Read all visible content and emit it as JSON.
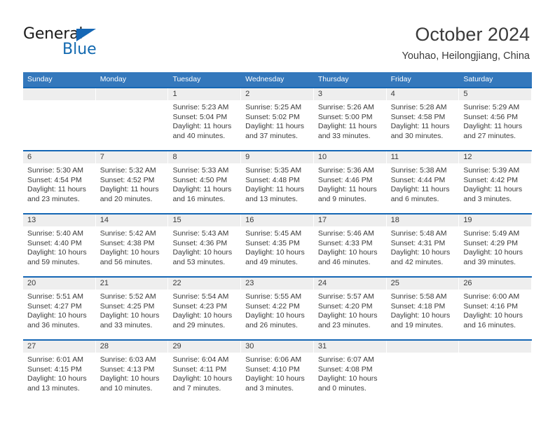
{
  "brand": {
    "name_top": "General",
    "name_bottom": "Blue",
    "triangle_color": "#1567b5",
    "blue_color": "#1269b0"
  },
  "header": {
    "title": "October 2024",
    "subtitle": "Youhao, Heilongjiang, China"
  },
  "theme": {
    "header_row_bg": "#3478bc",
    "week_border": "#1567b5",
    "date_band_bg": "#eeeeee",
    "text_color": "#3a3a3a"
  },
  "weekdays": [
    "Sunday",
    "Monday",
    "Tuesday",
    "Wednesday",
    "Thursday",
    "Friday",
    "Saturday"
  ],
  "weeks": [
    [
      {
        "date": "",
        "sunrise": "",
        "sunset": "",
        "daylight": ""
      },
      {
        "date": "",
        "sunrise": "",
        "sunset": "",
        "daylight": ""
      },
      {
        "date": "1",
        "sunrise": "Sunrise: 5:23 AM",
        "sunset": "Sunset: 5:04 PM",
        "daylight": "Daylight: 11 hours and 40 minutes."
      },
      {
        "date": "2",
        "sunrise": "Sunrise: 5:25 AM",
        "sunset": "Sunset: 5:02 PM",
        "daylight": "Daylight: 11 hours and 37 minutes."
      },
      {
        "date": "3",
        "sunrise": "Sunrise: 5:26 AM",
        "sunset": "Sunset: 5:00 PM",
        "daylight": "Daylight: 11 hours and 33 minutes."
      },
      {
        "date": "4",
        "sunrise": "Sunrise: 5:28 AM",
        "sunset": "Sunset: 4:58 PM",
        "daylight": "Daylight: 11 hours and 30 minutes."
      },
      {
        "date": "5",
        "sunrise": "Sunrise: 5:29 AM",
        "sunset": "Sunset: 4:56 PM",
        "daylight": "Daylight: 11 hours and 27 minutes."
      }
    ],
    [
      {
        "date": "6",
        "sunrise": "Sunrise: 5:30 AM",
        "sunset": "Sunset: 4:54 PM",
        "daylight": "Daylight: 11 hours and 23 minutes."
      },
      {
        "date": "7",
        "sunrise": "Sunrise: 5:32 AM",
        "sunset": "Sunset: 4:52 PM",
        "daylight": "Daylight: 11 hours and 20 minutes."
      },
      {
        "date": "8",
        "sunrise": "Sunrise: 5:33 AM",
        "sunset": "Sunset: 4:50 PM",
        "daylight": "Daylight: 11 hours and 16 minutes."
      },
      {
        "date": "9",
        "sunrise": "Sunrise: 5:35 AM",
        "sunset": "Sunset: 4:48 PM",
        "daylight": "Daylight: 11 hours and 13 minutes."
      },
      {
        "date": "10",
        "sunrise": "Sunrise: 5:36 AM",
        "sunset": "Sunset: 4:46 PM",
        "daylight": "Daylight: 11 hours and 9 minutes."
      },
      {
        "date": "11",
        "sunrise": "Sunrise: 5:38 AM",
        "sunset": "Sunset: 4:44 PM",
        "daylight": "Daylight: 11 hours and 6 minutes."
      },
      {
        "date": "12",
        "sunrise": "Sunrise: 5:39 AM",
        "sunset": "Sunset: 4:42 PM",
        "daylight": "Daylight: 11 hours and 3 minutes."
      }
    ],
    [
      {
        "date": "13",
        "sunrise": "Sunrise: 5:40 AM",
        "sunset": "Sunset: 4:40 PM",
        "daylight": "Daylight: 10 hours and 59 minutes."
      },
      {
        "date": "14",
        "sunrise": "Sunrise: 5:42 AM",
        "sunset": "Sunset: 4:38 PM",
        "daylight": "Daylight: 10 hours and 56 minutes."
      },
      {
        "date": "15",
        "sunrise": "Sunrise: 5:43 AM",
        "sunset": "Sunset: 4:36 PM",
        "daylight": "Daylight: 10 hours and 53 minutes."
      },
      {
        "date": "16",
        "sunrise": "Sunrise: 5:45 AM",
        "sunset": "Sunset: 4:35 PM",
        "daylight": "Daylight: 10 hours and 49 minutes."
      },
      {
        "date": "17",
        "sunrise": "Sunrise: 5:46 AM",
        "sunset": "Sunset: 4:33 PM",
        "daylight": "Daylight: 10 hours and 46 minutes."
      },
      {
        "date": "18",
        "sunrise": "Sunrise: 5:48 AM",
        "sunset": "Sunset: 4:31 PM",
        "daylight": "Daylight: 10 hours and 42 minutes."
      },
      {
        "date": "19",
        "sunrise": "Sunrise: 5:49 AM",
        "sunset": "Sunset: 4:29 PM",
        "daylight": "Daylight: 10 hours and 39 minutes."
      }
    ],
    [
      {
        "date": "20",
        "sunrise": "Sunrise: 5:51 AM",
        "sunset": "Sunset: 4:27 PM",
        "daylight": "Daylight: 10 hours and 36 minutes."
      },
      {
        "date": "21",
        "sunrise": "Sunrise: 5:52 AM",
        "sunset": "Sunset: 4:25 PM",
        "daylight": "Daylight: 10 hours and 33 minutes."
      },
      {
        "date": "22",
        "sunrise": "Sunrise: 5:54 AM",
        "sunset": "Sunset: 4:23 PM",
        "daylight": "Daylight: 10 hours and 29 minutes."
      },
      {
        "date": "23",
        "sunrise": "Sunrise: 5:55 AM",
        "sunset": "Sunset: 4:22 PM",
        "daylight": "Daylight: 10 hours and 26 minutes."
      },
      {
        "date": "24",
        "sunrise": "Sunrise: 5:57 AM",
        "sunset": "Sunset: 4:20 PM",
        "daylight": "Daylight: 10 hours and 23 minutes."
      },
      {
        "date": "25",
        "sunrise": "Sunrise: 5:58 AM",
        "sunset": "Sunset: 4:18 PM",
        "daylight": "Daylight: 10 hours and 19 minutes."
      },
      {
        "date": "26",
        "sunrise": "Sunrise: 6:00 AM",
        "sunset": "Sunset: 4:16 PM",
        "daylight": "Daylight: 10 hours and 16 minutes."
      }
    ],
    [
      {
        "date": "27",
        "sunrise": "Sunrise: 6:01 AM",
        "sunset": "Sunset: 4:15 PM",
        "daylight": "Daylight: 10 hours and 13 minutes."
      },
      {
        "date": "28",
        "sunrise": "Sunrise: 6:03 AM",
        "sunset": "Sunset: 4:13 PM",
        "daylight": "Daylight: 10 hours and 10 minutes."
      },
      {
        "date": "29",
        "sunrise": "Sunrise: 6:04 AM",
        "sunset": "Sunset: 4:11 PM",
        "daylight": "Daylight: 10 hours and 7 minutes."
      },
      {
        "date": "30",
        "sunrise": "Sunrise: 6:06 AM",
        "sunset": "Sunset: 4:10 PM",
        "daylight": "Daylight: 10 hours and 3 minutes."
      },
      {
        "date": "31",
        "sunrise": "Sunrise: 6:07 AM",
        "sunset": "Sunset: 4:08 PM",
        "daylight": "Daylight: 10 hours and 0 minutes."
      },
      {
        "date": "",
        "sunrise": "",
        "sunset": "",
        "daylight": ""
      },
      {
        "date": "",
        "sunrise": "",
        "sunset": "",
        "daylight": ""
      }
    ]
  ]
}
